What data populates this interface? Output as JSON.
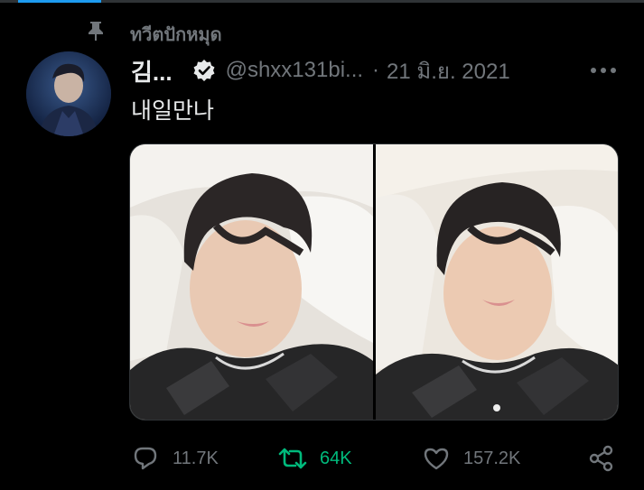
{
  "pinned": {
    "label": "ทวีตปักหมุด",
    "icon": "pin-icon"
  },
  "tweet": {
    "display_name": "김...",
    "handle": "@shxx131bi...",
    "separator": "·",
    "date": "21 มิ.ย. 2021",
    "text": "내일만나",
    "verified_icon": "verified-badge-icon",
    "more_icon": "more-dots-icon",
    "media": [
      {
        "name": "photo-left",
        "description_icon": "photo"
      },
      {
        "name": "photo-right",
        "description_icon": "photo"
      }
    ]
  },
  "actions": {
    "reply": {
      "icon": "reply-icon",
      "count": "11.7K"
    },
    "retweet": {
      "icon": "retweet-icon",
      "count": "64K",
      "active": true
    },
    "like": {
      "icon": "heart-icon",
      "count": "157.2K"
    },
    "share": {
      "icon": "share-icon"
    }
  },
  "colors": {
    "background": "#000000",
    "text_primary": "#e7e9ea",
    "text_secondary": "#71767b",
    "retweet_active": "#00ba7c",
    "border": "#2f3336"
  }
}
